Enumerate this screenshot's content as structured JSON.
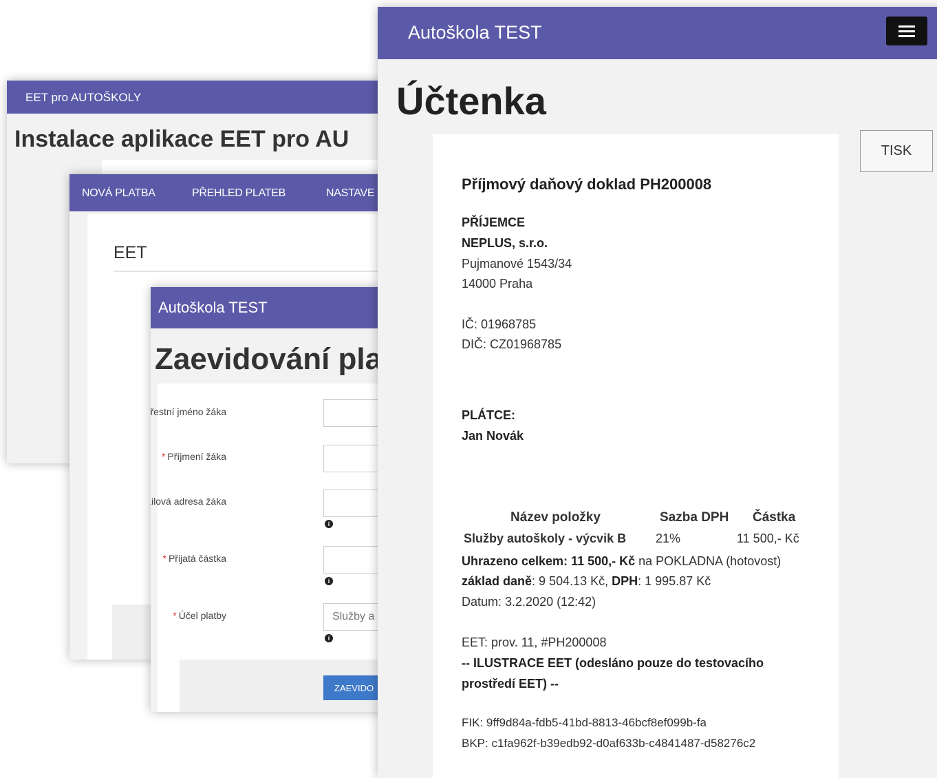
{
  "window_install": {
    "app_title": "EET pro AUTOŠKOLY",
    "heading": "Instalace aplikace EET pro AU"
  },
  "window_eet": {
    "nav": [
      "NOVÁ PLATBA",
      "PŘEHLED PLATEB",
      "NASTAVE"
    ],
    "section_title": "EET"
  },
  "window_form": {
    "app_title": "Autoškola TEST",
    "heading": "Zaevidování pla",
    "fields": [
      {
        "label": "Křestní jméno žáka",
        "required": true,
        "value": ""
      },
      {
        "label": "Příjmení žáka",
        "required": true,
        "value": ""
      },
      {
        "label": "E-mailová adresa žáka",
        "required": false,
        "value": ""
      },
      {
        "label": "Přijatá částka",
        "required": true,
        "value": ""
      },
      {
        "label": "Účel platby",
        "required": true,
        "value": "Služby a"
      }
    ],
    "submit_label": "ZAEVIDO"
  },
  "window_receipt": {
    "app_title": "Autoškola TEST",
    "menu_icon": "hamburger-menu-icon",
    "heading": "Účtenka",
    "print_label": "TISK",
    "doc_title": "Příjmový daňový doklad PH200008",
    "recipient_label": "PŘÍJEMCE",
    "recipient_name": "NEPLUS, s.r.o.",
    "recipient_street": "Pujmanové 1543/34",
    "recipient_city": "14000 Praha",
    "ic": "IČ: 01968785",
    "dic": "DIČ: CZ01968785",
    "payer_label": "PLÁTCE:",
    "payer_name": "Jan Novák",
    "table": {
      "col_name": "Název položky",
      "col_vat": "Sazba DPH",
      "col_amount": "Částka",
      "item_name": "Služby autoškoly - výcvik B",
      "item_vat": "21%",
      "item_amount": "11 500,- Kč"
    },
    "paid_label": "Uhrazeno celkem: 11 500,- Kč",
    "paid_method": " na POKLADNA (hotovost)",
    "tax_base_label": "základ daně",
    "tax_base_value": ": 9 504.13 Kč, ",
    "vat_label": "DPH",
    "vat_value": ": 1 995.87 Kč",
    "date": "Datum: 3.2.2020 (12:42)",
    "eet_line": "EET: prov. 11, #PH200008",
    "eet_note_1": "-- ILUSTRACE EET (odesláno pouze do testovacího",
    "eet_note_2": "prostředí EET) --",
    "fik": "FIK: 9ff9d84a-fdb5-41bd-8813-46bcf8ef099b-fa",
    "bkp": "BKP: c1fa962f-b39edb92-d0af633b-c4841487-d58276c2"
  },
  "colors": {
    "accent": "#5b5aa8",
    "button": "#3f79c9",
    "required": "#d9342b"
  }
}
